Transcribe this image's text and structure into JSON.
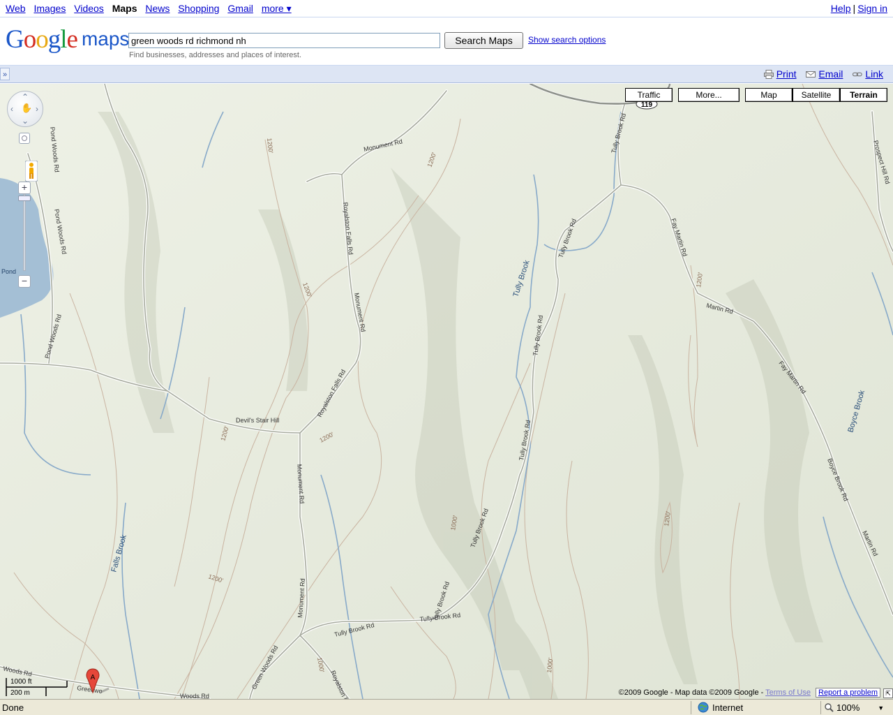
{
  "topnav": {
    "links": [
      {
        "label": "Web",
        "current": false
      },
      {
        "label": "Images",
        "current": false
      },
      {
        "label": "Videos",
        "current": false
      },
      {
        "label": "Maps",
        "current": true
      },
      {
        "label": "News",
        "current": false
      },
      {
        "label": "Shopping",
        "current": false
      },
      {
        "label": "Gmail",
        "current": false
      },
      {
        "label": "more ▾",
        "current": false
      }
    ],
    "help": "Help",
    "separator": "|",
    "signin": "Sign in"
  },
  "header": {
    "logo_text": "Google",
    "logo_sub": "maps",
    "search_value": "green woods rd richmond nh",
    "search_button": "Search Maps",
    "show_options": "Show search options",
    "hint": "Find businesses, addresses and places of interest."
  },
  "toolbar": {
    "collapse": "»",
    "print": "Print",
    "email": "Email",
    "link": "Link"
  },
  "map": {
    "buttons": {
      "traffic": "Traffic",
      "more": "More...",
      "map": "Map",
      "satellite": "Satellite",
      "terrain": "Terrain"
    },
    "selected_type": "Terrain",
    "marker_label": "A",
    "scale_ft": "1000 ft",
    "scale_m": "200 m",
    "copyright": "©2009 Google - Map data ©2009 Google -",
    "terms": "Terms of Use",
    "report": "Report a problem",
    "labels": {
      "route": "119",
      "monument_rd": "Monument Rd",
      "royalston_falls_rd": "Royalston Falls Rd",
      "pond_woods_rd": "Pond Woods Rd",
      "pond": "Pond",
      "tully_brook": "Tully Brook",
      "tully_brook_rd": "Tully Brook Rd",
      "fay_martin_rd": "Fay Martin Rd",
      "martin_rd": "Martin Rd",
      "prospect_hill_rd": "Prospect Hill Rd",
      "boyce_brook": "Boyce Brook",
      "boyce_brook_rd": "Boyce Brook Rd",
      "devils_stair_hill": "Devil's Stair Hill",
      "falls_brook": "Falls Brook",
      "green_woods_rd": "Green Woods Rd",
      "c1200": "1200'",
      "c1000": "1000'",
      "greenwo": "Greenwo",
      "woods_rd": "Woods Rd"
    }
  },
  "statusbar": {
    "status": "Done",
    "zone": "Internet",
    "zoom": "100%"
  }
}
